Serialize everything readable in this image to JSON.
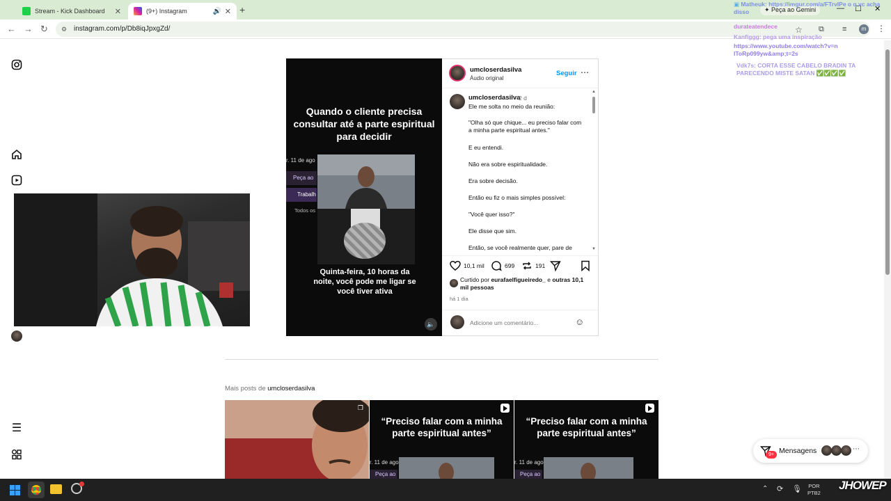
{
  "browser": {
    "tabs": [
      {
        "title": "Stream - Kick Dashboard"
      },
      {
        "title": "(9+) Instagram"
      }
    ],
    "url": "instagram.com/p/Db8iqJpxgZd/"
  },
  "post": {
    "username": "umcloserdasilva",
    "audio": "Áudio original",
    "follow_label": "Seguir",
    "media_text_top": "Quando o cliente precisa consultar até a parte espiritual para decidir",
    "media_text_bottom": "Quinta-feira, 10 horas da noite, você pode me ligar se você tiver ativa",
    "inner_date": "r. 11 de ago",
    "inner_menu": [
      "Peça ao",
      "Trabalh",
      "Todos os"
    ],
    "caption": {
      "username": "umcloserdasilva",
      "age": "2 d",
      "lines": [
        "Ele me solta no meio da reunião:",
        "\"Olha só que chique... eu preciso falar com a minha parte espiritual antes.\"",
        "E eu entendi.",
        "Não era sobre espiritualidade.",
        "Era sobre decisão.",
        "Então eu fiz o mais simples possível:",
        "\"Você quer isso?\"",
        "Ele disse que sim.",
        "Então, se você realmente quer, pare de"
      ]
    },
    "likes": "10,1 mil",
    "comments": "699",
    "reposts": "191",
    "liked_by_prefix": "Curtido por",
    "liked_by_user": "eurafaelfigueiredo_",
    "liked_by_and": "e",
    "liked_by_others": "outras 10,1 mil pessoas",
    "posted_ago": "há 1 dia",
    "comment_placeholder": "Adicione um comentário..."
  },
  "more_posts": {
    "prefix": "Mais posts de",
    "username": "umcloserdasilva",
    "thumbs": [
      {
        "text": ""
      },
      {
        "text": "“Preciso falar com a minha parte espiritual antes”",
        "date": "r. 11 de ago",
        "menu": "Peça ao"
      },
      {
        "text": "“Preciso falar com a minha parte espiritual antes”",
        "date": "r. 11 de ago",
        "menu": "Peça ao"
      }
    ]
  },
  "messages": {
    "label": "Mensagens",
    "badge": "9+"
  },
  "chat_overlay": [
    {
      "user": "Matheuk",
      "text": ": https://imgur.com/a/FTrvIPe o q vc acha disso",
      "color": "#7b8fe6"
    },
    {
      "user": "durateatendece",
      "text": "",
      "color": "#c77ddb"
    },
    {
      "user": "Kanfiggg",
      "text": ": pega uma inspiração",
      "color": "#b59be6"
    },
    {
      "user": "",
      "text": "https://www.youtube.com/watch?v=nIToRp099yw&amp;t=2s",
      "color": "#8e7fe6"
    },
    {
      "user": "Vdk7s",
      "text": ": CORTA ESSE CABELO BRADIN TA PARECENDO MISTE SATAN ✅✅✅✅",
      "color": "#a99ee6"
    }
  ],
  "gemini_label": "Peça ao Gemini",
  "taskbar": {
    "lang": "POR",
    "layout": "PTB2"
  },
  "watermark": "JHOWEP"
}
